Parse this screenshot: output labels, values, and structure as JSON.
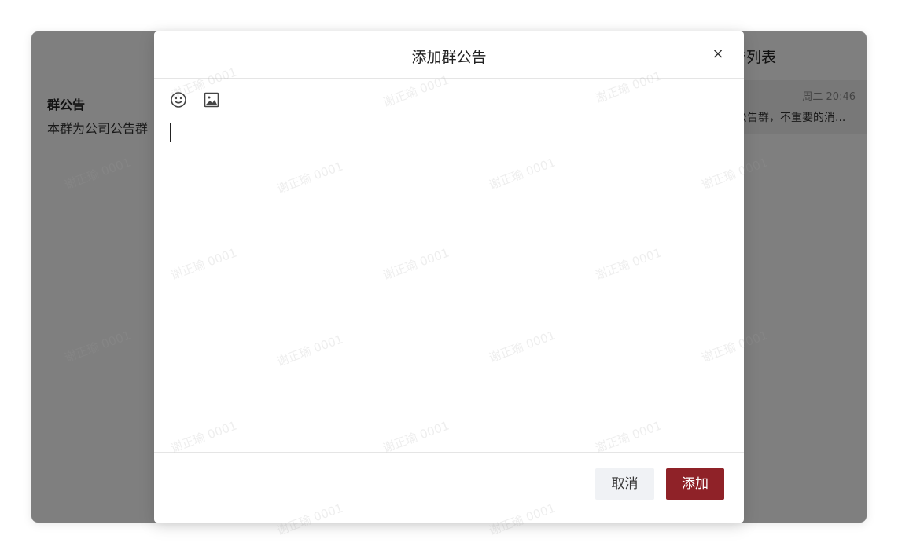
{
  "background_panel": {
    "right_title": "告列表",
    "left_notice_title": "群公告",
    "left_notice_body": "本群为公司公告群",
    "list_item": {
      "time": "周二 20:46",
      "preview": "公告群，不重要的消..."
    }
  },
  "modal": {
    "title": "添加群公告",
    "close_label": "×",
    "toolbar": {
      "emoji_icon": "smile-icon",
      "image_icon": "image-icon"
    },
    "editor_value": "",
    "cancel_label": "取消",
    "confirm_label": "添加"
  },
  "watermark_text": "谢正瑜 0001",
  "colors": {
    "primary": "#8f2228",
    "cancel_bg": "#f0f2f5",
    "overlay": "rgba(0,0,0,0.5)"
  }
}
